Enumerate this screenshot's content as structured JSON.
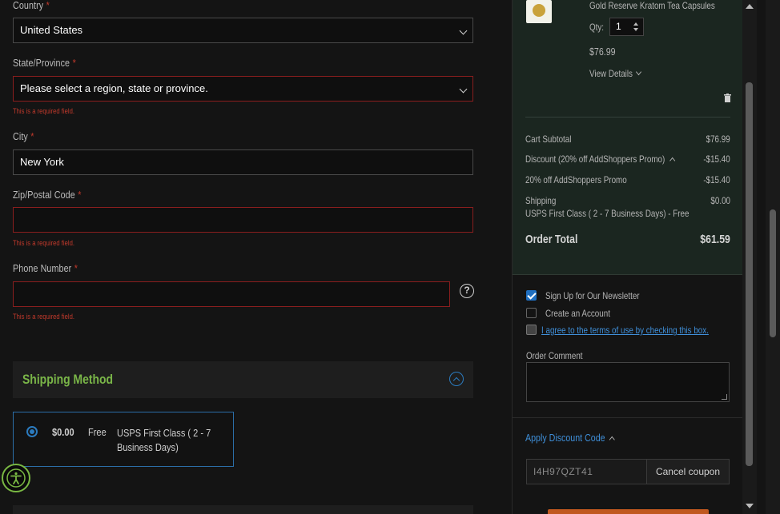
{
  "form": {
    "country": {
      "label": "Country",
      "required": "*",
      "value": "United States"
    },
    "state": {
      "label": "State/Province",
      "required": "*",
      "value": "Please select a region, state or province.",
      "error": "This is a required field."
    },
    "city": {
      "label": "City",
      "required": "*",
      "value": "New York"
    },
    "zip": {
      "label": "Zip/Postal Code",
      "required": "*",
      "value": "",
      "error": "This is a required field."
    },
    "phone": {
      "label": "Phone Number",
      "required": "*",
      "value": "",
      "error": "This is a required field.",
      "help": "?"
    }
  },
  "shipping": {
    "title": "Shipping Method",
    "option": {
      "price": "$0.00",
      "free": "Free",
      "name": "USPS First Class ( 2 - 7 Business Days)"
    }
  },
  "cart": {
    "product": {
      "name": "Gold Reserve Kratom Tea Capsules",
      "qty_label": "Qty:",
      "qty": "1",
      "price": "$76.99",
      "view_details": "View Details"
    },
    "subtotal": {
      "label": "Cart Subtotal",
      "value": "$76.99"
    },
    "discount": {
      "label": "Discount (20% off AddShoppers Promo)",
      "value": "-$15.40"
    },
    "promo": {
      "label": "20% off AddShoppers Promo",
      "value": "-$15.40"
    },
    "shipping": {
      "label": "Shipping",
      "value": "$0.00",
      "method": "USPS First Class ( 2 - 7 Business Days) - Free"
    },
    "total": {
      "label": "Order Total",
      "value": "$61.59"
    }
  },
  "options": {
    "newsletter": {
      "label": "Sign Up for Our Newsletter",
      "checked": true
    },
    "account": {
      "label": "Create an Account",
      "checked": false
    },
    "terms": {
      "label": "I agree to the terms of use by checking this box.",
      "checked": false
    }
  },
  "comment": {
    "label": "Order Comment"
  },
  "discount_code": {
    "title": "Apply Discount Code",
    "code": "I4H97QZT41",
    "cancel": "Cancel coupon"
  },
  "colors": {
    "accent_green": "#7ab648",
    "link_blue": "#3f8fd9",
    "error_red": "#c0392b",
    "summary_bg": "#1b2620"
  }
}
